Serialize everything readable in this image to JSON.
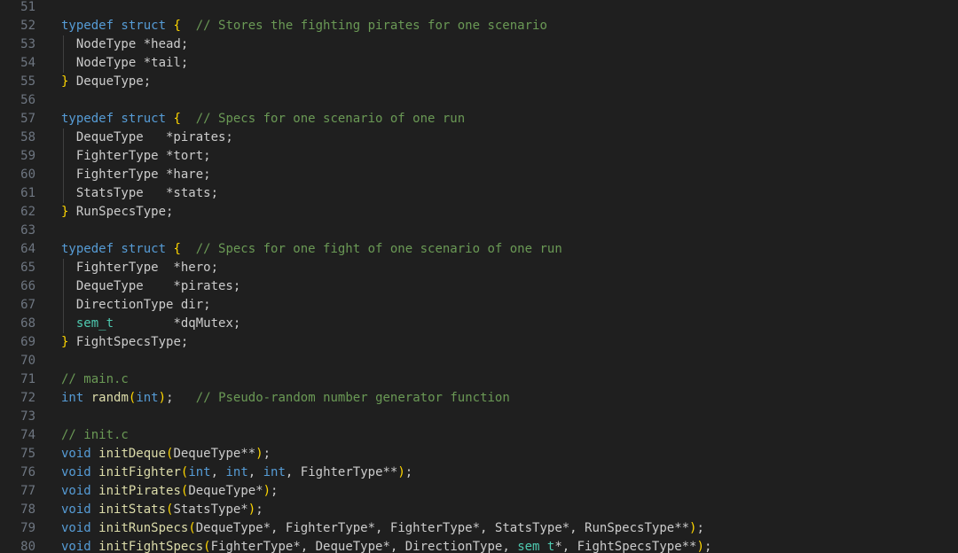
{
  "editor": {
    "lines": [
      {
        "n": "51",
        "tokens": []
      },
      {
        "n": "52",
        "tokens": [
          {
            "t": "typedef struct ",
            "c": "kw"
          },
          {
            "t": "{",
            "c": "br"
          },
          {
            "t": "  ",
            "c": "tx"
          },
          {
            "t": "// Stores the fighting pirates for one scenario",
            "c": "cm"
          }
        ]
      },
      {
        "n": "53",
        "guide": true,
        "tokens": [
          {
            "t": "  NodeType *head;",
            "c": "tx"
          }
        ]
      },
      {
        "n": "54",
        "guide": true,
        "tokens": [
          {
            "t": "  NodeType *tail;",
            "c": "tx"
          }
        ]
      },
      {
        "n": "55",
        "tokens": [
          {
            "t": "}",
            "c": "br"
          },
          {
            "t": " DequeType;",
            "c": "tx"
          }
        ]
      },
      {
        "n": "56",
        "tokens": []
      },
      {
        "n": "57",
        "tokens": [
          {
            "t": "typedef struct ",
            "c": "kw"
          },
          {
            "t": "{",
            "c": "br"
          },
          {
            "t": "  ",
            "c": "tx"
          },
          {
            "t": "// Specs for one scenario of one run",
            "c": "cm"
          }
        ]
      },
      {
        "n": "58",
        "guide": true,
        "tokens": [
          {
            "t": "  DequeType   *pirates;",
            "c": "tx"
          }
        ]
      },
      {
        "n": "59",
        "guide": true,
        "tokens": [
          {
            "t": "  FighterType *tort;",
            "c": "tx"
          }
        ]
      },
      {
        "n": "60",
        "guide": true,
        "tokens": [
          {
            "t": "  FighterType *hare;",
            "c": "tx"
          }
        ]
      },
      {
        "n": "61",
        "guide": true,
        "tokens": [
          {
            "t": "  StatsType   *stats;",
            "c": "tx"
          }
        ]
      },
      {
        "n": "62",
        "tokens": [
          {
            "t": "}",
            "c": "br"
          },
          {
            "t": " RunSpecsType;",
            "c": "tx"
          }
        ]
      },
      {
        "n": "63",
        "tokens": []
      },
      {
        "n": "64",
        "tokens": [
          {
            "t": "typedef struct ",
            "c": "kw"
          },
          {
            "t": "{",
            "c": "br"
          },
          {
            "t": "  ",
            "c": "tx"
          },
          {
            "t": "// Specs for one fight of one scenario of one run",
            "c": "cm"
          }
        ]
      },
      {
        "n": "65",
        "guide": true,
        "tokens": [
          {
            "t": "  FighterType  *hero;",
            "c": "tx"
          }
        ]
      },
      {
        "n": "66",
        "guide": true,
        "tokens": [
          {
            "t": "  DequeType    *pirates;",
            "c": "tx"
          }
        ]
      },
      {
        "n": "67",
        "guide": true,
        "tokens": [
          {
            "t": "  DirectionType dir;",
            "c": "tx"
          }
        ]
      },
      {
        "n": "68",
        "guide": true,
        "tokens": [
          {
            "t": "  ",
            "c": "tx"
          },
          {
            "t": "sem_t",
            "c": "type"
          },
          {
            "t": "        *dqMutex;",
            "c": "tx"
          }
        ]
      },
      {
        "n": "69",
        "tokens": [
          {
            "t": "}",
            "c": "br"
          },
          {
            "t": " FightSpecsType;",
            "c": "tx"
          }
        ]
      },
      {
        "n": "70",
        "tokens": []
      },
      {
        "n": "71",
        "tokens": [
          {
            "t": "// main.c",
            "c": "cm"
          }
        ]
      },
      {
        "n": "72",
        "tokens": [
          {
            "t": "int",
            "c": "kw"
          },
          {
            "t": " ",
            "c": "tx"
          },
          {
            "t": "randm",
            "c": "fn"
          },
          {
            "t": "(",
            "c": "br"
          },
          {
            "t": "int",
            "c": "kw"
          },
          {
            "t": ")",
            "c": "br"
          },
          {
            "t": ";   ",
            "c": "tx"
          },
          {
            "t": "// Pseudo-random number generator function",
            "c": "cm"
          }
        ]
      },
      {
        "n": "73",
        "tokens": []
      },
      {
        "n": "74",
        "tokens": [
          {
            "t": "// init.c",
            "c": "cm"
          }
        ]
      },
      {
        "n": "75",
        "tokens": [
          {
            "t": "void",
            "c": "kw"
          },
          {
            "t": " ",
            "c": "tx"
          },
          {
            "t": "initDeque",
            "c": "fn"
          },
          {
            "t": "(",
            "c": "br"
          },
          {
            "t": "DequeType**",
            "c": "tx"
          },
          {
            "t": ")",
            "c": "br"
          },
          {
            "t": ";",
            "c": "tx"
          }
        ]
      },
      {
        "n": "76",
        "tokens": [
          {
            "t": "void",
            "c": "kw"
          },
          {
            "t": " ",
            "c": "tx"
          },
          {
            "t": "initFighter",
            "c": "fn"
          },
          {
            "t": "(",
            "c": "br"
          },
          {
            "t": "int",
            "c": "kw"
          },
          {
            "t": ", ",
            "c": "tx"
          },
          {
            "t": "int",
            "c": "kw"
          },
          {
            "t": ", ",
            "c": "tx"
          },
          {
            "t": "int",
            "c": "kw"
          },
          {
            "t": ", FighterType**",
            "c": "tx"
          },
          {
            "t": ")",
            "c": "br"
          },
          {
            "t": ";",
            "c": "tx"
          }
        ]
      },
      {
        "n": "77",
        "tokens": [
          {
            "t": "void",
            "c": "kw"
          },
          {
            "t": " ",
            "c": "tx"
          },
          {
            "t": "initPirates",
            "c": "fn"
          },
          {
            "t": "(",
            "c": "br"
          },
          {
            "t": "DequeType*",
            "c": "tx"
          },
          {
            "t": ")",
            "c": "br"
          },
          {
            "t": ";",
            "c": "tx"
          }
        ]
      },
      {
        "n": "78",
        "tokens": [
          {
            "t": "void",
            "c": "kw"
          },
          {
            "t": " ",
            "c": "tx"
          },
          {
            "t": "initStats",
            "c": "fn"
          },
          {
            "t": "(",
            "c": "br"
          },
          {
            "t": "StatsType*",
            "c": "tx"
          },
          {
            "t": ")",
            "c": "br"
          },
          {
            "t": ";",
            "c": "tx"
          }
        ]
      },
      {
        "n": "79",
        "tokens": [
          {
            "t": "void",
            "c": "kw"
          },
          {
            "t": " ",
            "c": "tx"
          },
          {
            "t": "initRunSpecs",
            "c": "fn"
          },
          {
            "t": "(",
            "c": "br"
          },
          {
            "t": "DequeType*, FighterType*, FighterType*, StatsType*, RunSpecsType**",
            "c": "tx"
          },
          {
            "t": ")",
            "c": "br"
          },
          {
            "t": ";",
            "c": "tx"
          }
        ]
      },
      {
        "n": "80",
        "tokens": [
          {
            "t": "void",
            "c": "kw"
          },
          {
            "t": " ",
            "c": "tx"
          },
          {
            "t": "initFightSpecs",
            "c": "fn"
          },
          {
            "t": "(",
            "c": "br"
          },
          {
            "t": "FighterType*, DequeType*, DirectionType, ",
            "c": "tx"
          },
          {
            "t": "sem_t",
            "c": "type"
          },
          {
            "t": "*, FightSpecsType**",
            "c": "tx"
          },
          {
            "t": ")",
            "c": "br"
          },
          {
            "t": ";",
            "c": "tx"
          }
        ]
      }
    ]
  }
}
